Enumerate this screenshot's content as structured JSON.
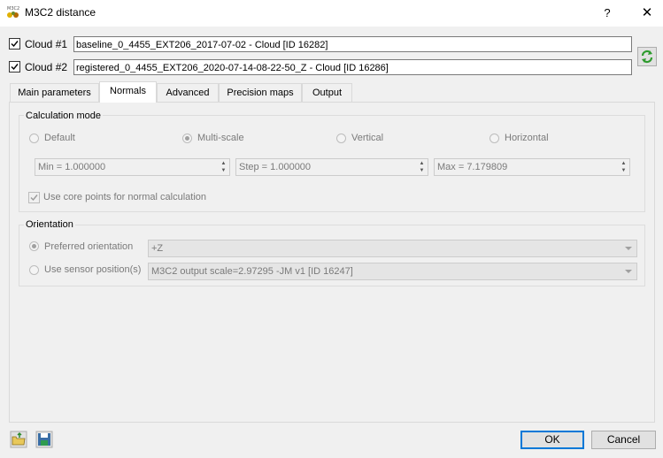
{
  "window": {
    "title": "M3C2 distance",
    "help_label": "?",
    "close_label": "✕"
  },
  "cloud1": {
    "label": "Cloud #1",
    "checked": true,
    "value": "baseline_0_4455_EXT206_2017-07-02 - Cloud [ID 16282]"
  },
  "cloud2": {
    "label": "Cloud #2",
    "checked": true,
    "value": "registered_0_4455_EXT206_2020-07-14-08-22-50_Z - Cloud [ID 16286]"
  },
  "tabs": [
    {
      "label": "Main parameters",
      "active": false
    },
    {
      "label": "Normals",
      "active": true
    },
    {
      "label": "Advanced",
      "active": false
    },
    {
      "label": "Precision maps",
      "active": false
    },
    {
      "label": "Output",
      "active": false
    }
  ],
  "calculation_mode": {
    "title": "Calculation mode",
    "options": [
      {
        "label": "Default",
        "checked": false
      },
      {
        "label": "Multi-scale",
        "checked": true
      },
      {
        "label": "Vertical",
        "checked": false
      },
      {
        "label": "Horizontal",
        "checked": false
      }
    ],
    "min": "Min = 1.000000",
    "step": "Step = 1.000000",
    "max": "Max = 7.179809",
    "core_points": {
      "label": "Use core points for normal calculation",
      "checked": true
    }
  },
  "orientation": {
    "title": "Orientation",
    "preferred": {
      "label": "Preferred orientation",
      "checked": true,
      "value": "+Z"
    },
    "sensor": {
      "label": "Use sensor position(s)",
      "checked": false,
      "value": "M3C2 output scale=2.97295 -JM v1 [ID 16247]"
    }
  },
  "buttons": {
    "ok": "OK",
    "cancel": "Cancel"
  },
  "icons": {
    "app": "m3c2-app-icon",
    "swap": "swap-clouds-icon",
    "load": "load-params-icon",
    "save": "save-params-icon"
  }
}
